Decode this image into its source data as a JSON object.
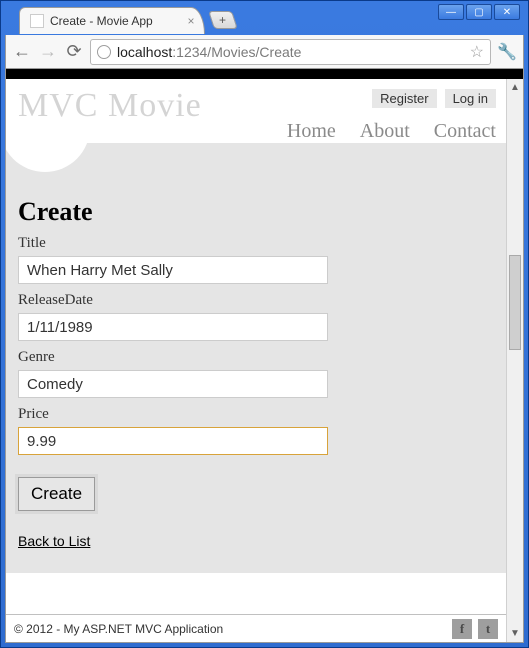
{
  "window": {
    "tab_title": "Create - Movie App",
    "url_host": "localhost",
    "url_port_path": ":1234/Movies/Create"
  },
  "header": {
    "logo": "MVC Movie",
    "auth": {
      "register": "Register",
      "login": "Log in"
    },
    "nav": {
      "home": "Home",
      "about": "About",
      "contact": "Contact"
    }
  },
  "page": {
    "title": "Create",
    "fields": {
      "title": {
        "label": "Title",
        "value": "When Harry Met Sally"
      },
      "release": {
        "label": "ReleaseDate",
        "value": "1/11/1989"
      },
      "genre": {
        "label": "Genre",
        "value": "Comedy"
      },
      "price": {
        "label": "Price",
        "value": "9.99"
      }
    },
    "submit_label": "Create",
    "back_link": "Back to List"
  },
  "footer": {
    "copyright": "© 2012 - My ASP.NET MVC Application"
  }
}
